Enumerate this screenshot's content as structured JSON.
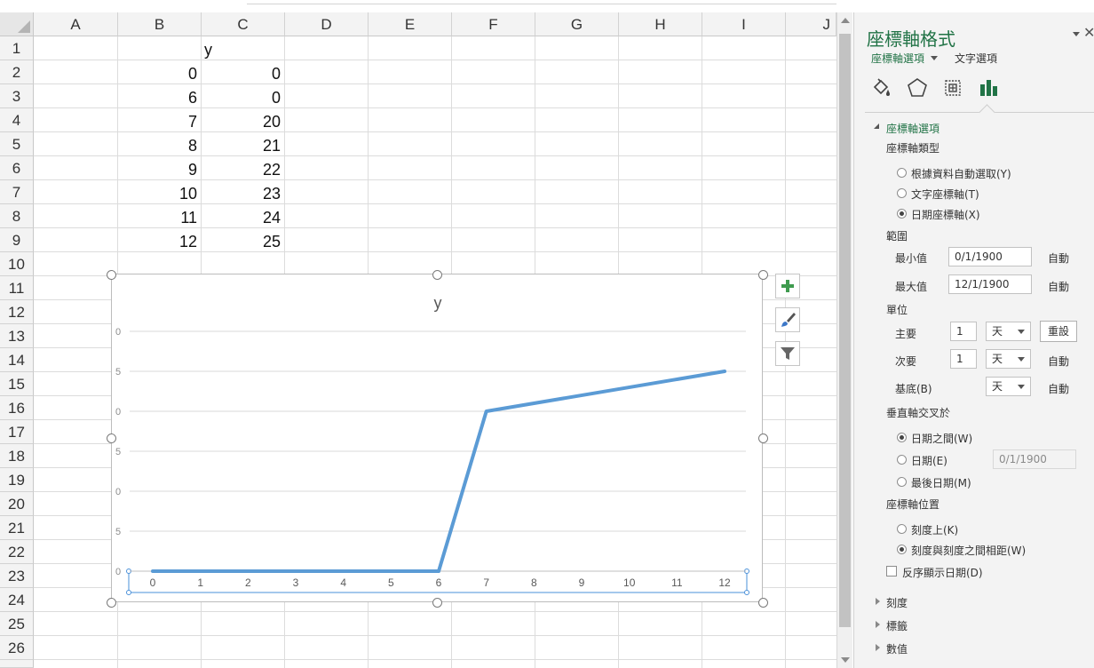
{
  "sheet": {
    "columns": [
      "A",
      "B",
      "C",
      "D",
      "E",
      "F",
      "G",
      "H",
      "I",
      "J"
    ],
    "rows": [
      "1",
      "2",
      "3",
      "4",
      "5",
      "6",
      "7",
      "8",
      "9",
      "10",
      "11",
      "12",
      "13",
      "14",
      "15",
      "16",
      "17",
      "18",
      "19",
      "20",
      "21",
      "22",
      "23",
      "24",
      "25",
      "26"
    ],
    "c1_header": "y",
    "b_values": [
      "0",
      "6",
      "7",
      "8",
      "9",
      "10",
      "11",
      "12"
    ],
    "c_values": [
      "0",
      "0",
      "20",
      "21",
      "22",
      "23",
      "24",
      "25"
    ]
  },
  "chart": {
    "title": "y",
    "line_color": "#5b9bd5"
  },
  "chart_data": {
    "type": "line",
    "title": "y",
    "categories": [
      "0",
      "1",
      "2",
      "3",
      "4",
      "5",
      "6",
      "7",
      "8",
      "9",
      "10",
      "11",
      "12"
    ],
    "x": [
      0,
      6,
      7,
      12
    ],
    "series": [
      {
        "values": [
          0,
          0,
          20,
          25
        ]
      }
    ],
    "y_tick_labels": [
      "0",
      "5",
      "0",
      "5",
      "0",
      "5",
      "0"
    ],
    "ylim": [
      0,
      30
    ],
    "grid": true,
    "legend": "none"
  },
  "pane": {
    "title": "座標軸格式",
    "sub_tab_active": "座標軸選項",
    "sub_tab_other": "文字選項",
    "icons": [
      "paint-bucket-icon",
      "pentagon-icon",
      "size-properties-icon",
      "bar-chart-icon"
    ],
    "section_axis_options": "座標軸選項",
    "axis_type_label": "座標軸類型",
    "axis_type_options": [
      "根據資料自動選取(Y)",
      "文字座標軸(T)",
      "日期座標軸(X)"
    ],
    "axis_type_selected": 2,
    "bounds_label": "範圍",
    "min_label": "最小值",
    "min_value": "0/1/1900",
    "min_auto": "自動",
    "max_label": "最大值",
    "max_value": "12/1/1900",
    "max_auto": "自動",
    "units_label": "單位",
    "major_label": "主要",
    "major_value": "1",
    "major_unit": "天",
    "reset_button": "重設",
    "minor_label": "次要",
    "minor_value": "1",
    "minor_unit": "天",
    "minor_auto": "自動",
    "base_label": "基底(B)",
    "base_unit": "天",
    "base_auto": "自動",
    "crosses_label": "垂直軸交叉於",
    "crosses_options": [
      "日期之間(W)",
      "日期(E)",
      "最後日期(M)"
    ],
    "crosses_selected": 0,
    "crosses_date_value": "0/1/1900",
    "position_label": "座標軸位置",
    "position_options": [
      "刻度上(K)",
      "刻度與刻度之間相距(W)"
    ],
    "position_selected": 1,
    "reverse_label": "反序顯示日期(D)",
    "collapsed_sections": [
      "刻度",
      "標籤",
      "數值"
    ],
    "accent": "#217346"
  }
}
